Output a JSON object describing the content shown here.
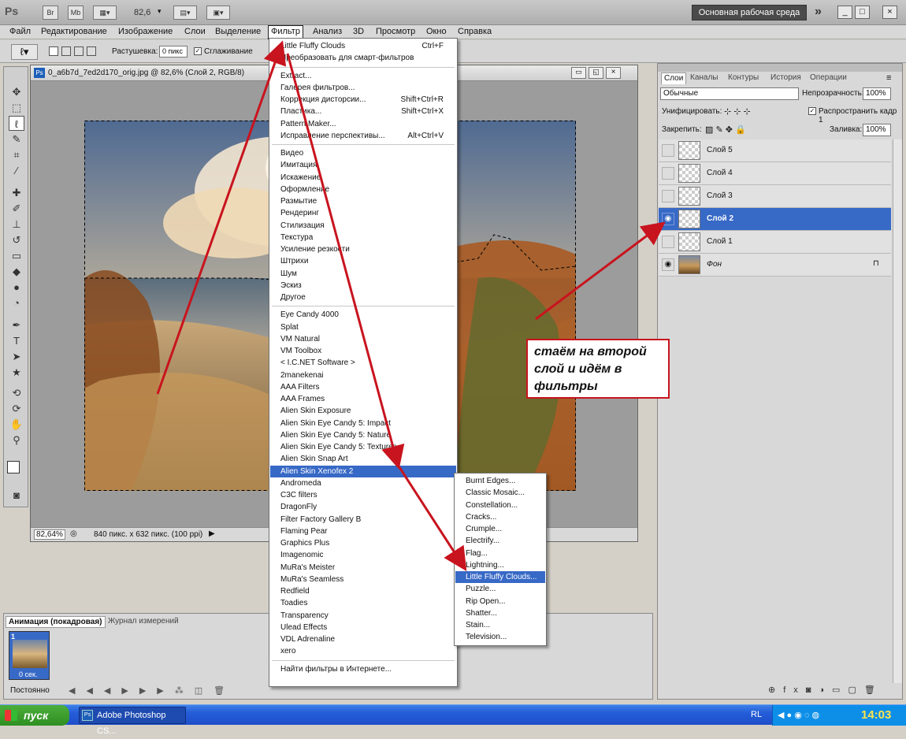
{
  "titlebar": {
    "app_logo": "Ps",
    "btn_br": "Br",
    "btn_mb": "Mb",
    "zoom": "82,6",
    "workspace": "Основная рабочая среда",
    "more": "»",
    "minimize": "_",
    "restore": "□",
    "close": "×"
  },
  "menubar": {
    "items": [
      "Файл",
      "Редактирование",
      "Изображение",
      "Слои",
      "Выделение",
      "Фильтр",
      "Анализ",
      "3D",
      "Просмотр",
      "Окно",
      "Справка"
    ]
  },
  "options": {
    "feather_label": "Растушевка:",
    "feather_value": "0 пикс",
    "antialias_label": "Сглаживание"
  },
  "document": {
    "title": "0_a6b7d_7ed2d170_orig.jpg @ 82,6% (Слой 2, RGB/8)",
    "zoom": "82,64%",
    "size_info": "840 пикс. x 632 пикс. (100 ppi)"
  },
  "filter_menu": {
    "top_items": [
      {
        "label": "Little Fluffy Clouds",
        "shortcut": "Ctrl+F"
      },
      {
        "label": "Преобразовать для смарт-фильтров",
        "shortcut": ""
      }
    ],
    "group2": [
      {
        "label": "Extract...",
        "shortcut": ""
      },
      {
        "label": "Галерея фильтров...",
        "shortcut": ""
      },
      {
        "label": "Коррекция дисторсии...",
        "shortcut": "Shift+Ctrl+R"
      },
      {
        "label": "Пластика...",
        "shortcut": "Shift+Ctrl+X"
      },
      {
        "label": "Pattern Maker...",
        "shortcut": ""
      },
      {
        "label": "Исправление перспективы...",
        "shortcut": "Alt+Ctrl+V"
      }
    ],
    "builtin": [
      "Видео",
      "Имитация",
      "Искажение",
      "Оформление",
      "Размытие",
      "Рендеринг",
      "Стилизация",
      "Текстура",
      "Усиление резкости",
      "Штрихи",
      "Шум",
      "Эскиз",
      "Другое"
    ],
    "plugins": [
      "Eye Candy 4000",
      "Splat",
      "VM Natural",
      "VM Toolbox",
      "< I.C.NET Software >",
      "2manekenai",
      "AAA Filters",
      "AAA Frames",
      "Alien Skin Exposure",
      "Alien Skin Eye Candy 5: Impact",
      "Alien Skin Eye Candy 5: Nature",
      "Alien Skin Eye Candy 5: Textures",
      "Alien Skin Snap Art",
      "Alien Skin Xenofex 2",
      "Andromeda",
      "C3C filters",
      "DragonFly",
      "Filter Factory Gallery B",
      "Flaming Pear",
      "Graphics Plus",
      "Imagenomic",
      "MuRa's Meister",
      "MuRa's Seamless",
      "Redfield",
      "Toadies",
      "Transparency",
      "Ulead Effects",
      "VDL Adrenaline",
      "xero"
    ],
    "highlighted": "Alien Skin Xenofex 2",
    "bottom": "Найти фильтры в Интернете..."
  },
  "submenu": {
    "items": [
      "Burnt Edges...",
      "Classic Mosaic...",
      "Constellation...",
      "Cracks...",
      "Crumple...",
      "Electrify...",
      "Flag...",
      "Lightning...",
      "Little Fluffy Clouds...",
      "Puzzle...",
      "Rip Open...",
      "Shatter...",
      "Stain...",
      "Television..."
    ],
    "highlighted": "Little Fluffy Clouds..."
  },
  "layers_panel": {
    "tabs": [
      "Слои",
      "Каналы",
      "Контуры",
      "История",
      "Операции"
    ],
    "blend_mode": "Обычные",
    "opacity_label": "Непрозрачность:",
    "opacity_value": "100%",
    "unify_label": "Унифицировать:",
    "propagate_label": "Распространить кадр 1",
    "lock_label": "Закрепить:",
    "fill_label": "Заливка:",
    "fill_value": "100%",
    "layers": [
      {
        "name": "Слой 5",
        "visible": false,
        "selected": false
      },
      {
        "name": "Слой 4",
        "visible": false,
        "selected": false
      },
      {
        "name": "Слой 3",
        "visible": false,
        "selected": false
      },
      {
        "name": "Слой 2",
        "visible": true,
        "selected": true
      },
      {
        "name": "Слой 1",
        "visible": false,
        "selected": false
      },
      {
        "name": "Фон",
        "visible": true,
        "selected": false
      }
    ]
  },
  "animation_panel": {
    "tab_active": "Анимация (покадровая)",
    "tab_other": "Журнал измерений",
    "frame_number": "1",
    "frame_delay": "0 сек.",
    "loop": "Постоянно"
  },
  "annotation": {
    "text": "стаём на второй слой и идём в фильтры"
  },
  "taskbar": {
    "start": "пуск",
    "app": "Adobe Photoshop CS...",
    "lang": "RL",
    "clock": "14:03"
  },
  "colors": {
    "highlight": "#3769c6",
    "arrow": "#c8141e"
  }
}
